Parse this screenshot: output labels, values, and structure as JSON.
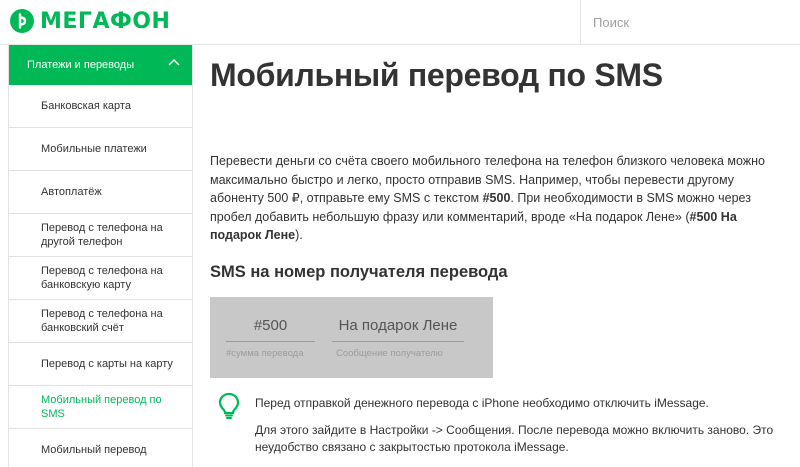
{
  "header": {
    "logo_text": "МЕГАФОН",
    "search_placeholder": "Поиск",
    "brand_color": "#00b956"
  },
  "sidebar": {
    "section_title": "Платежи и переводы",
    "items": [
      {
        "label": "Банковская карта",
        "active": false
      },
      {
        "label": "Мобильные платежи",
        "active": false
      },
      {
        "label": "Автоплатёж",
        "active": false
      },
      {
        "label": "Перевод с телефона на другой телефон",
        "active": false
      },
      {
        "label": "Перевод с телефона на банковскую карту",
        "active": false
      },
      {
        "label": "Перевод с телефона на банковский счёт",
        "active": false
      },
      {
        "label": "Перевод с карты на карту",
        "active": false
      },
      {
        "label": "Мобильный перевод по SMS",
        "active": true
      },
      {
        "label": "Мобильный перевод",
        "active": false
      }
    ]
  },
  "main": {
    "title": "Мобильный перевод по SMS",
    "intro": {
      "text1": "Перевести деньги со счёта своего мобильного телефона на телефон близкого человека можно максимально быстро и легко, просто отправив SMS. Например, чтобы перевести другому абоненту 500 ₽, отправьте ему SMS с текстом ",
      "bold1": "#500",
      "text2": ". При необходимости в SMS можно через пробел добавить небольшую фразу или комментарий, вроде «На подарок Лене» (",
      "bold2": "#500 На подарок Лене",
      "text3": ")."
    },
    "sms_heading": "SMS на номер получателя перевода",
    "sms_example": {
      "amount_value": "#500",
      "amount_hint": "#сумма перевода",
      "message_value": "На подарок Лене",
      "message_hint": "Сообщение получателю"
    },
    "tip": {
      "icon": "lightbulb-icon",
      "line1": "Перед отправкой денежного перевода с iPhone необходимо отключить iMessage.",
      "line2": "Для этого зайдите в Настройки -> Сообщения. После перевода можно включить заново. Это неудобство связано с закрытостью протокола iMessage."
    }
  }
}
